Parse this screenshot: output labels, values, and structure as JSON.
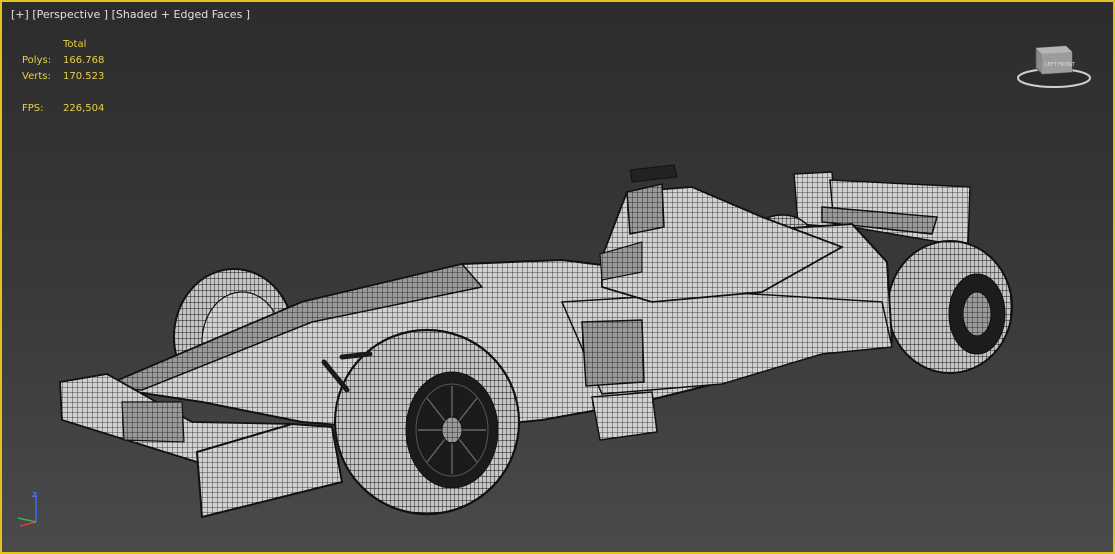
{
  "viewport": {
    "label_plus": "[+]",
    "label_view": "[Perspective ]",
    "label_shading": "[Shaded + Edged Faces ]"
  },
  "stats": {
    "header": "Total",
    "polys_label": "Polys:",
    "polys_value": "166.768",
    "verts_label": "Verts:",
    "verts_value": "170.523",
    "fps_label": "FPS:",
    "fps_value": "226,504"
  },
  "viewcube": {
    "left_face": "LEFT",
    "front_face": "FRONT"
  },
  "axis": {
    "z_label": "z"
  },
  "colors": {
    "viewport_border": "#e5c21a",
    "stats_text": "#e6d14a"
  }
}
